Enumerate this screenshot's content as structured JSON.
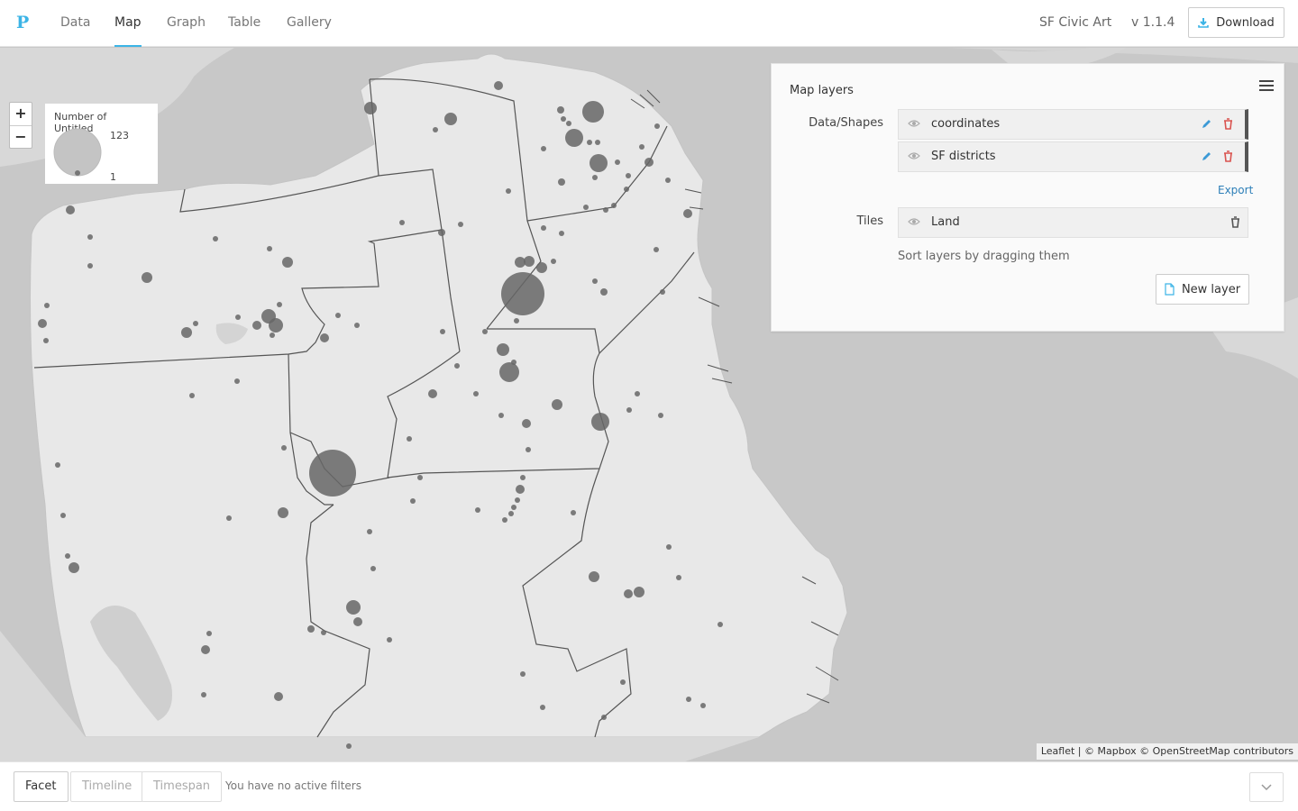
{
  "app": {
    "logo_letter": "P",
    "nav": [
      "Data",
      "Map",
      "Graph",
      "Table",
      "Gallery"
    ],
    "active_tab": "Map",
    "project_title": "SF Civic Art",
    "version": "v 1.1.4",
    "download_label": "Download"
  },
  "map": {
    "zoom_in": "+",
    "zoom_out": "−",
    "legend": {
      "title": "Number of Untitled",
      "max_label": "123",
      "min_label": "1"
    },
    "attribution": "Leaflet | © Mapbox © OpenStreetMap contributors",
    "colors": {
      "water": "#c8c8c8",
      "land": "#e8e8e8",
      "marker": "#666666",
      "accent": "#3cb4e6"
    }
  },
  "layers_panel": {
    "title": "Map layers",
    "data_section_label": "Data/Shapes",
    "data_layers": [
      {
        "name": "coordinates"
      },
      {
        "name": "SF districts"
      }
    ],
    "export_label": "Export",
    "tiles_section_label": "Tiles",
    "tile_layers": [
      {
        "name": "Land"
      }
    ],
    "sort_hint": "Sort layers by dragging them",
    "new_layer_label": "New layer",
    "colors": {
      "edit": "#3c9ad6",
      "delete": "#d9534f"
    }
  },
  "footer": {
    "facet_label": "Facet",
    "timeline_label": "Timeline",
    "timespan_label": "Timespan",
    "filters_text": "You have no active filters"
  }
}
